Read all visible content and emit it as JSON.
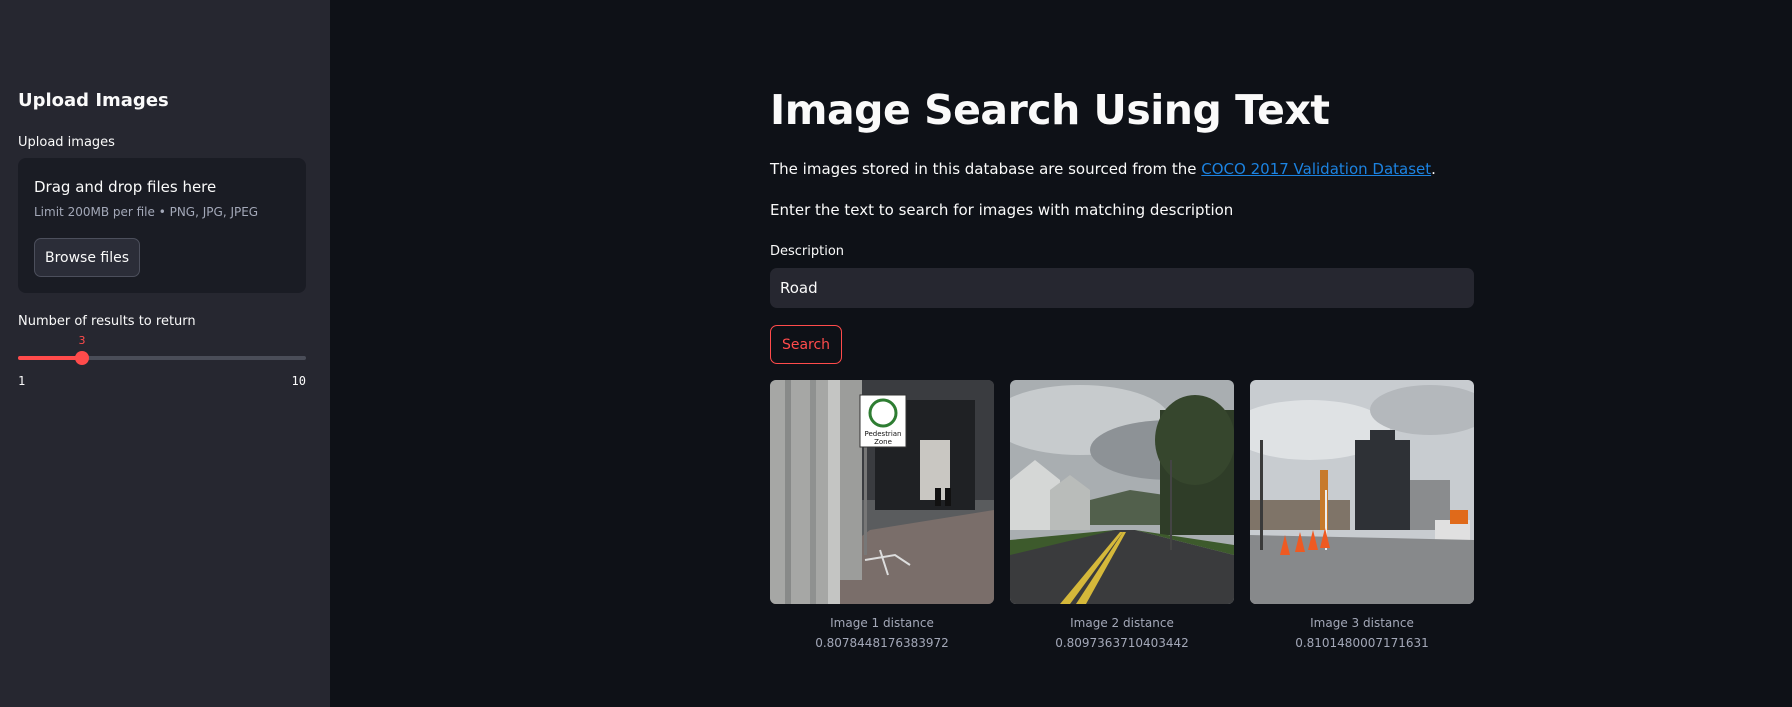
{
  "sidebar": {
    "title": "Upload Images",
    "uploader": {
      "label": "Upload images",
      "drop_text": "Drag and drop files here",
      "limit_text": "Limit 200MB per file • PNG, JPG, JPEG",
      "browse_label": "Browse files"
    },
    "slider": {
      "label": "Number of results to return",
      "value": "3",
      "min": "1",
      "max": "10"
    }
  },
  "main": {
    "title": "Image Search Using Text",
    "source_prefix": "The images stored in this database are sourced from the ",
    "source_link": "COCO 2017 Validation Dataset",
    "source_suffix": ".",
    "instructions": "Enter the text to search for images with matching description",
    "description_label": "Description",
    "description_value": "Road",
    "search_label": "Search",
    "results": [
      {
        "label": "Image 1 distance",
        "distance": "0.8078448176383972"
      },
      {
        "label": "Image 2 distance",
        "distance": "0.8097363710403442"
      },
      {
        "label": "Image 3 distance",
        "distance": "0.8101480007171631"
      }
    ]
  },
  "colors": {
    "background": "#0e1117",
    "sidebar": "#262730",
    "accent": "#ff4b4b",
    "link": "#1c83e1"
  }
}
